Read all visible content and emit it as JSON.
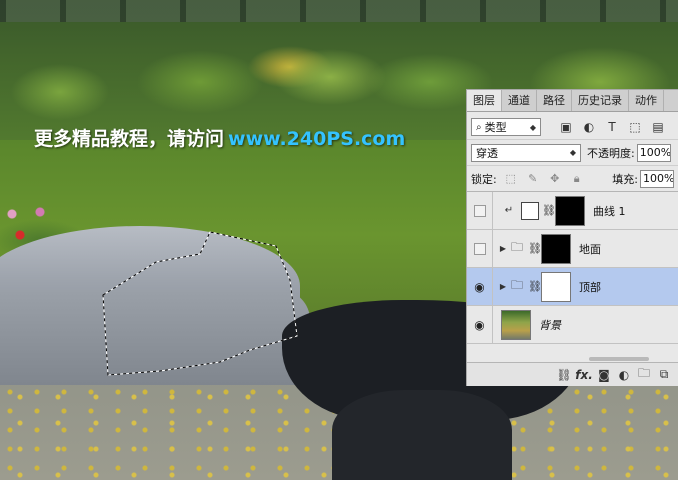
{
  "watermark": {
    "chinese_text": "更多精品教程，请访问",
    "url_text": "www.240PS.com"
  },
  "panel": {
    "tabs": [
      {
        "label": "图层",
        "active": true
      },
      {
        "label": "通道",
        "active": false
      },
      {
        "label": "路径",
        "active": false
      },
      {
        "label": "历史记录",
        "active": false
      },
      {
        "label": "动作",
        "active": false
      }
    ],
    "filter": {
      "search_icon": "search-icon",
      "value": "类型"
    },
    "filter_icons": [
      "image-filter-icon",
      "adjustment-filter-icon",
      "type-filter-icon",
      "shape-filter-icon",
      "smart-object-filter-icon"
    ],
    "blend_mode": "穿透",
    "opacity_label": "不透明度:",
    "opacity_value": "100%",
    "lock_label": "锁定:",
    "fill_label": "填充:",
    "fill_value": "100%",
    "layers": [
      {
        "name": "曲线 1",
        "visible": false,
        "selected": false,
        "type": "adjustment"
      },
      {
        "name": "地面",
        "visible": false,
        "selected": false,
        "type": "group"
      },
      {
        "name": "顶部",
        "visible": true,
        "selected": true,
        "type": "group"
      },
      {
        "name": "背景",
        "visible": true,
        "selected": false,
        "type": "background"
      }
    ],
    "bottom_icons": [
      "link-icon",
      "fx-icon",
      "mask-icon",
      "adjustment-icon",
      "folder-icon",
      "new-layer-icon"
    ],
    "fx_label": "fx."
  },
  "colors": {
    "watermark_url": "#34c3ff",
    "selected_layer": "#b4c9ee",
    "panel_bg": "#e8e8e8"
  }
}
